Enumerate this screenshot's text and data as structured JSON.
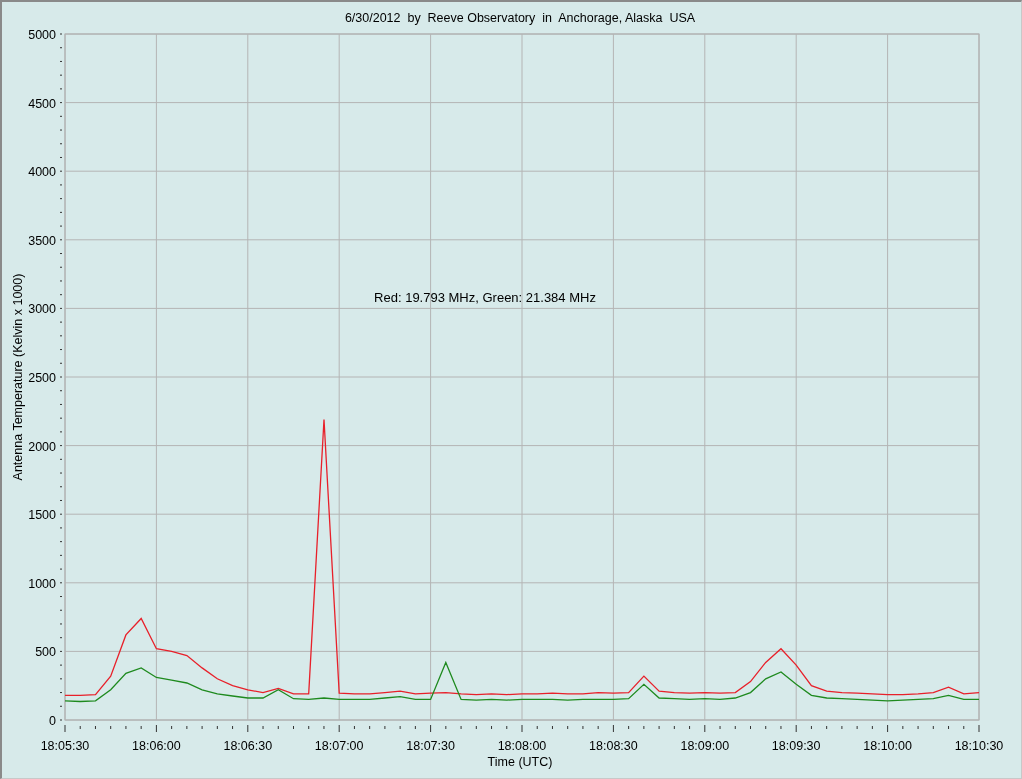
{
  "chart": {
    "chart_data": {
      "type": "line",
      "title": "6/30/2012  by  Reeve Observatory  in  Anchorage, Alaska  USA",
      "xlabel": "Time (UTC)",
      "ylabel": "Antenna Temperature (Kelvin x 1000)",
      "categories": [
        "18:05:30",
        null,
        null,
        null,
        null,
        null,
        "18:06:00",
        null,
        null,
        null,
        null,
        null,
        "18:06:30",
        null,
        null,
        null,
        null,
        null,
        "18:07:00",
        null,
        null,
        null,
        null,
        null,
        "18:07:30",
        null,
        null,
        null,
        null,
        null,
        "18:08:00",
        null,
        null,
        null,
        null,
        null,
        "18:08:30",
        null,
        null,
        null,
        null,
        null,
        "18:09:00",
        null,
        null,
        null,
        null,
        null,
        "18:09:30",
        null,
        null,
        null,
        null,
        null,
        "18:10:00",
        null,
        null,
        null,
        null,
        null,
        "18:10:30"
      ],
      "series": [
        {
          "color": "#e8202a",
          "values": [
            180,
            180,
            185,
            320,
            620,
            740,
            520,
            500,
            470,
            380,
            300,
            250,
            220,
            200,
            230,
            190,
            190,
            2190,
            195,
            190,
            190,
            200,
            210,
            190,
            195,
            200,
            190,
            185,
            190,
            185,
            190,
            190,
            195,
            190,
            190,
            200,
            195,
            200,
            320,
            210,
            200,
            195,
            200,
            195,
            200,
            280,
            420,
            520,
            400,
            250,
            210,
            200,
            195,
            190,
            185,
            185,
            190,
            200,
            240,
            190,
            200
          ]
        },
        {
          "color": "#1e8a1e",
          "values": [
            140,
            135,
            140,
            220,
            340,
            380,
            310,
            290,
            270,
            220,
            190,
            175,
            160,
            160,
            220,
            155,
            150,
            160,
            150,
            150,
            150,
            160,
            170,
            150,
            150,
            420,
            150,
            145,
            150,
            145,
            150,
            150,
            150,
            145,
            150,
            150,
            150,
            155,
            260,
            160,
            155,
            150,
            155,
            150,
            160,
            200,
            300,
            350,
            260,
            180,
            160,
            155,
            150,
            145,
            140,
            145,
            150,
            155,
            180,
            150,
            150
          ]
        }
      ],
      "ylim": [
        0,
        5000
      ],
      "grid": true,
      "yticks": [
        0,
        500,
        1000,
        1500,
        2000,
        2500,
        3000,
        3500,
        4000,
        4500,
        5000
      ],
      "annotations": [
        "Red: 19.793 MHz, Green: 21.384 MHz"
      ]
    }
  }
}
